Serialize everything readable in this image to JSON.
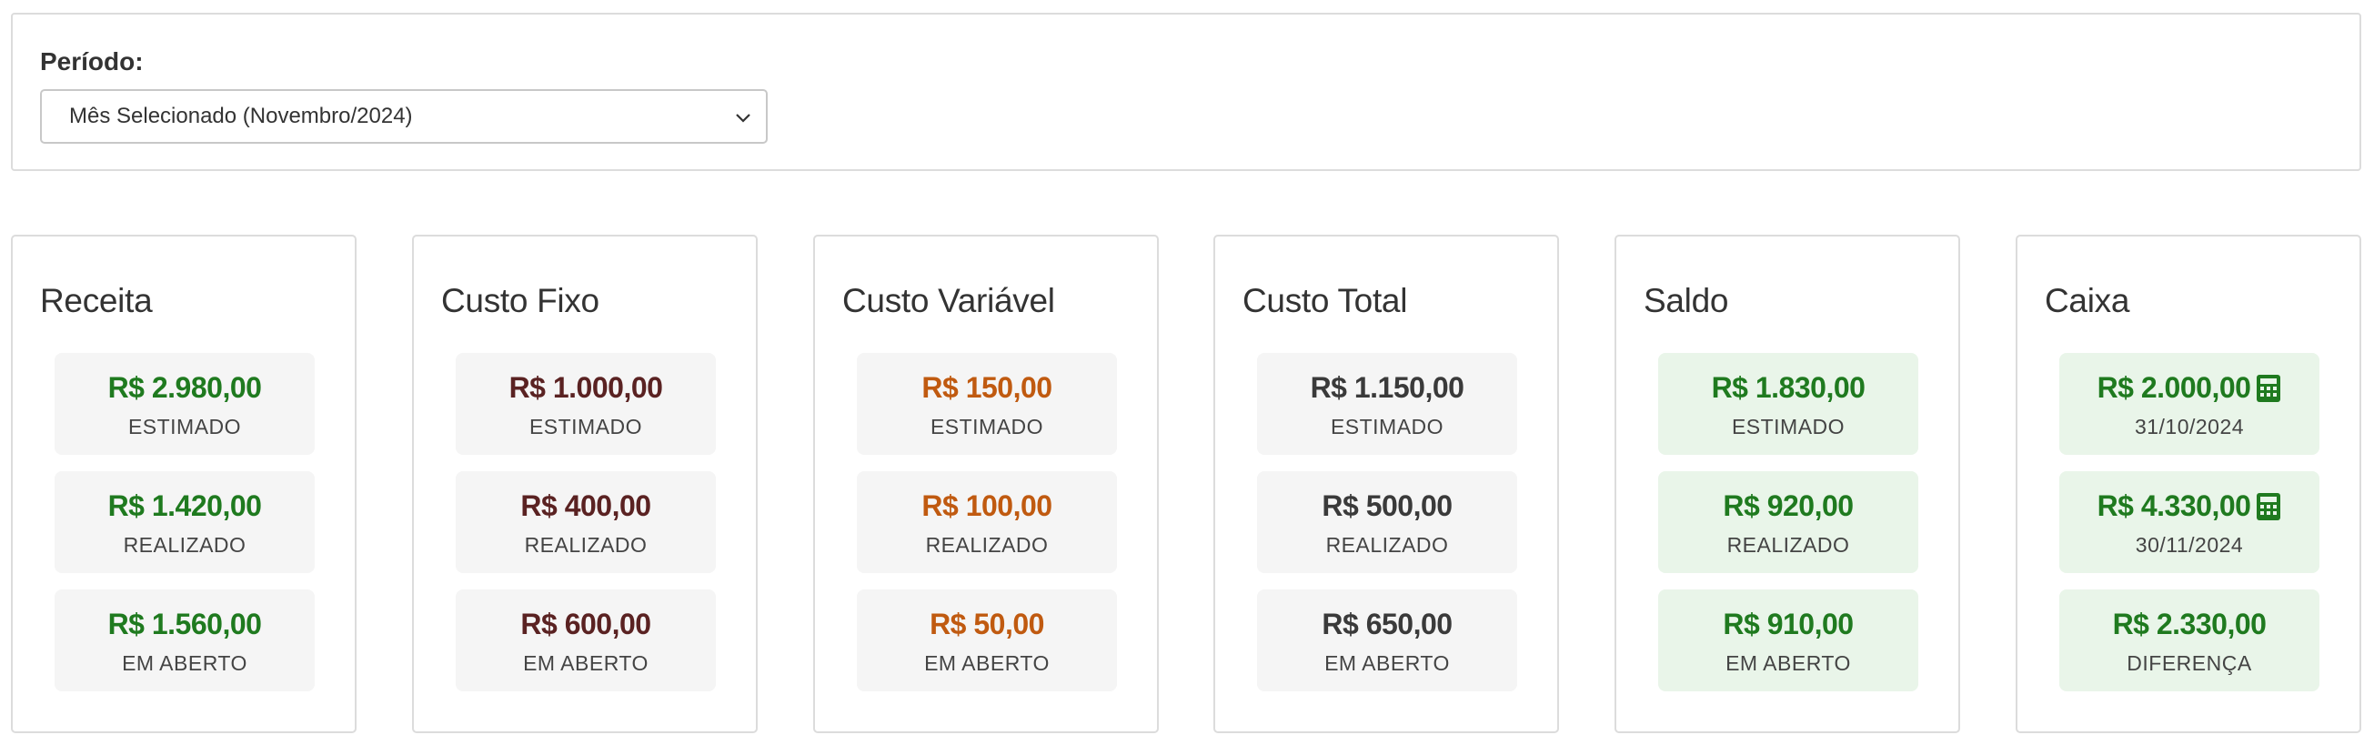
{
  "period": {
    "label": "Período:",
    "selected": "Mês Selecionado (Novembro/2024)"
  },
  "colors": {
    "green": "#1f7a1f",
    "maroon": "#5a2222",
    "orange": "#c05a10",
    "dark": "#3a3a3a",
    "green_bg": "#e9f5e9"
  },
  "cards": [
    {
      "title": "Receita",
      "stats": [
        {
          "value": "R$ 2.980,00",
          "label": "ESTIMADO"
        },
        {
          "value": "R$ 1.420,00",
          "label": "REALIZADO"
        },
        {
          "value": "R$ 1.560,00",
          "label": "EM ABERTO"
        }
      ]
    },
    {
      "title": "Custo Fixo",
      "stats": [
        {
          "value": "R$ 1.000,00",
          "label": "ESTIMADO"
        },
        {
          "value": "R$ 400,00",
          "label": "REALIZADO"
        },
        {
          "value": "R$ 600,00",
          "label": "EM ABERTO"
        }
      ]
    },
    {
      "title": "Custo Variável",
      "stats": [
        {
          "value": "R$ 150,00",
          "label": "ESTIMADO"
        },
        {
          "value": "R$ 100,00",
          "label": "REALIZADO"
        },
        {
          "value": "R$ 50,00",
          "label": "EM ABERTO"
        }
      ]
    },
    {
      "title": "Custo Total",
      "stats": [
        {
          "value": "R$ 1.150,00",
          "label": "ESTIMADO"
        },
        {
          "value": "R$ 500,00",
          "label": "REALIZADO"
        },
        {
          "value": "R$ 650,00",
          "label": "EM ABERTO"
        }
      ]
    },
    {
      "title": "Saldo",
      "stats": [
        {
          "value": "R$ 1.830,00",
          "label": "ESTIMADO"
        },
        {
          "value": "R$ 920,00",
          "label": "REALIZADO"
        },
        {
          "value": "R$ 910,00",
          "label": "EM ABERTO"
        }
      ]
    },
    {
      "title": "Caixa",
      "stats": [
        {
          "value": "R$ 2.000,00",
          "label": "31/10/2024",
          "icon": "calculator-icon"
        },
        {
          "value": "R$ 4.330,00",
          "label": "30/11/2024",
          "icon": "calculator-icon"
        },
        {
          "value": "R$ 2.330,00",
          "label": "DIFERENÇA"
        }
      ]
    }
  ]
}
